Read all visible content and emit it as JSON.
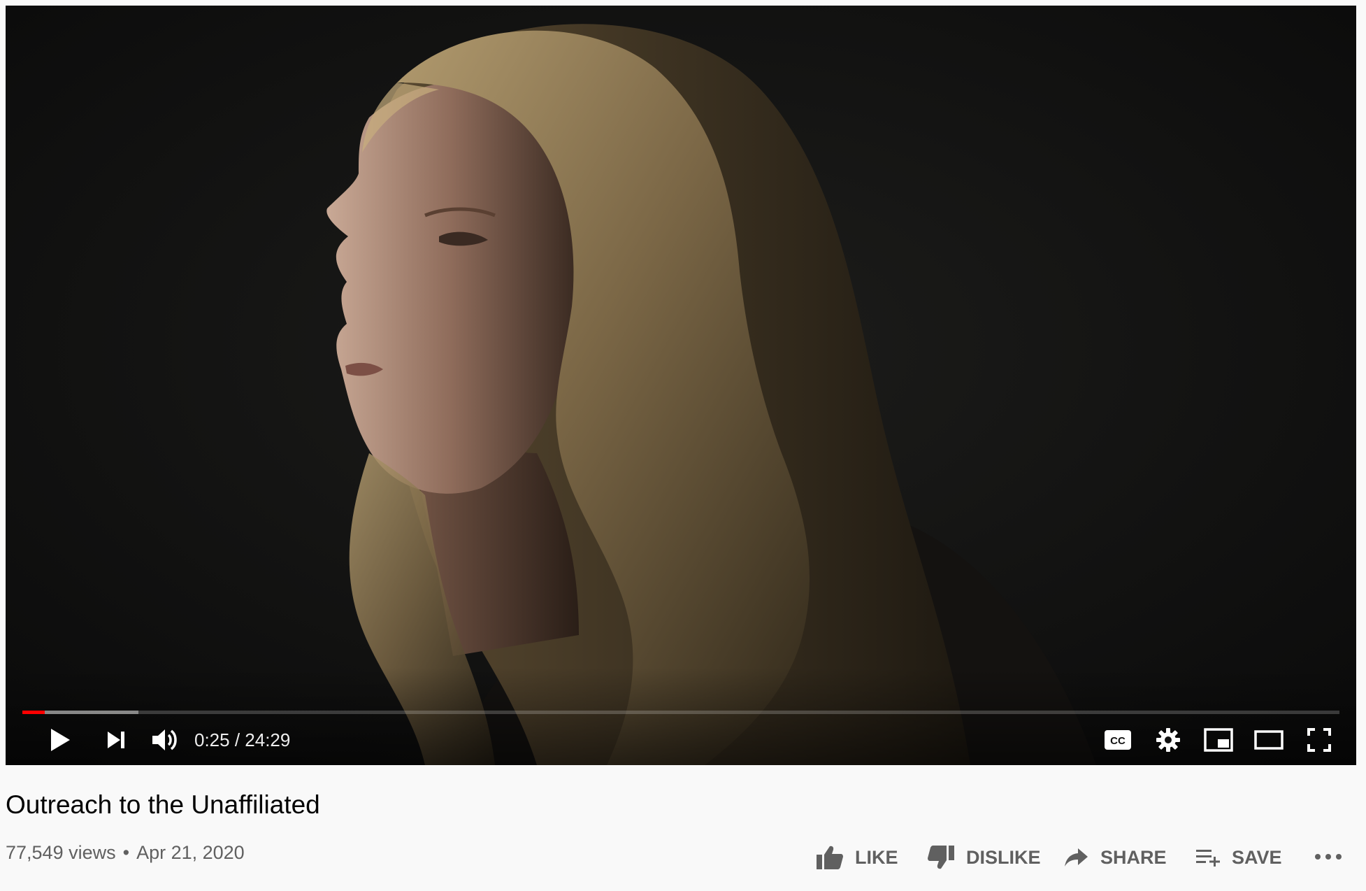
{
  "player": {
    "current_time": "0:25",
    "separator": " / ",
    "duration": "24:29",
    "played_fraction": 0.017,
    "buffered_fraction": 0.088,
    "accent_color": "#ff0000",
    "controls": {
      "play_icon": "play-icon",
      "next_icon": "next-icon",
      "volume_icon": "volume-icon",
      "cc_icon": "closed-captions-icon",
      "settings_icon": "gear-icon",
      "miniplayer_icon": "miniplayer-icon",
      "theater_icon": "theater-mode-icon",
      "fullscreen_icon": "fullscreen-icon"
    }
  },
  "video": {
    "title": "Outreach to the Unaffiliated",
    "views": "77,549 views",
    "dot": "•",
    "date": "Apr 21, 2020"
  },
  "actions": {
    "like_label": "LIKE",
    "dislike_label": "DISLIKE",
    "share_label": "SHARE",
    "save_label": "SAVE",
    "more_icon": "more-horizontal-icon"
  }
}
